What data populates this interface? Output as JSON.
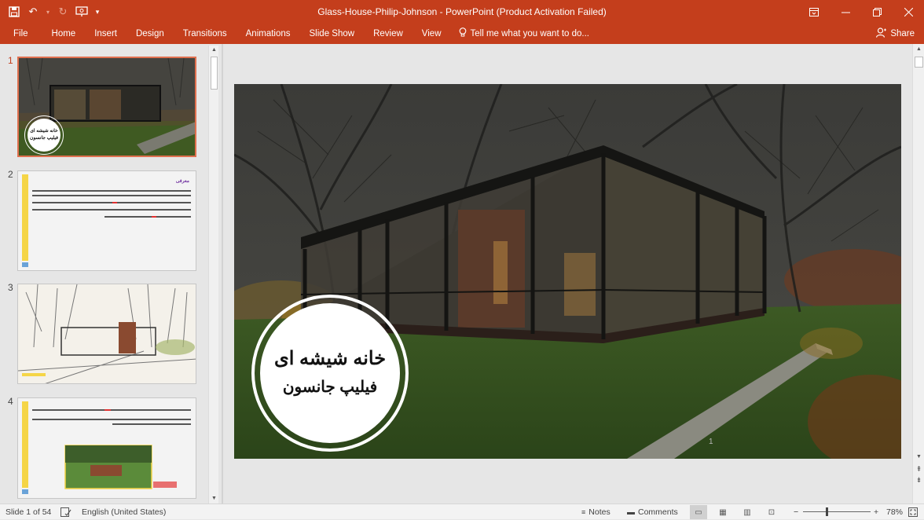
{
  "window": {
    "title": "Glass-House-Philip-Johnson - PowerPoint (Product Activation Failed)"
  },
  "quick_access": {
    "save_icon": "save-icon",
    "undo_icon": "undo-icon",
    "redo_icon": "redo-icon",
    "present_icon": "present-from-beginning-icon",
    "customize_icon": "customize-qat-icon"
  },
  "ribbon": {
    "tabs": [
      "File",
      "Home",
      "Insert",
      "Design",
      "Transitions",
      "Animations",
      "Slide Show",
      "Review",
      "View"
    ],
    "tell_me": "Tell me what you want to do...",
    "share": "Share"
  },
  "thumbnails": [
    {
      "number": "1",
      "active": true,
      "title_line1": "خانه شیشه ای",
      "title_line2": "فیلیپ جانسون"
    },
    {
      "number": "2",
      "active": false,
      "heading": "معرفی"
    },
    {
      "number": "3",
      "active": false
    },
    {
      "number": "4",
      "active": false
    }
  ],
  "slide": {
    "title_line1": "خانه شیشه ای",
    "title_line2": "فیلیپ جانسون",
    "page_number": "1"
  },
  "status": {
    "slide_info": "Slide 1 of 54",
    "language": "English (United States)",
    "notes": "Notes",
    "comments": "Comments",
    "zoom": "78%"
  },
  "colors": {
    "accent": "#c43e1c",
    "thumb_active_border": "#e0704f"
  }
}
